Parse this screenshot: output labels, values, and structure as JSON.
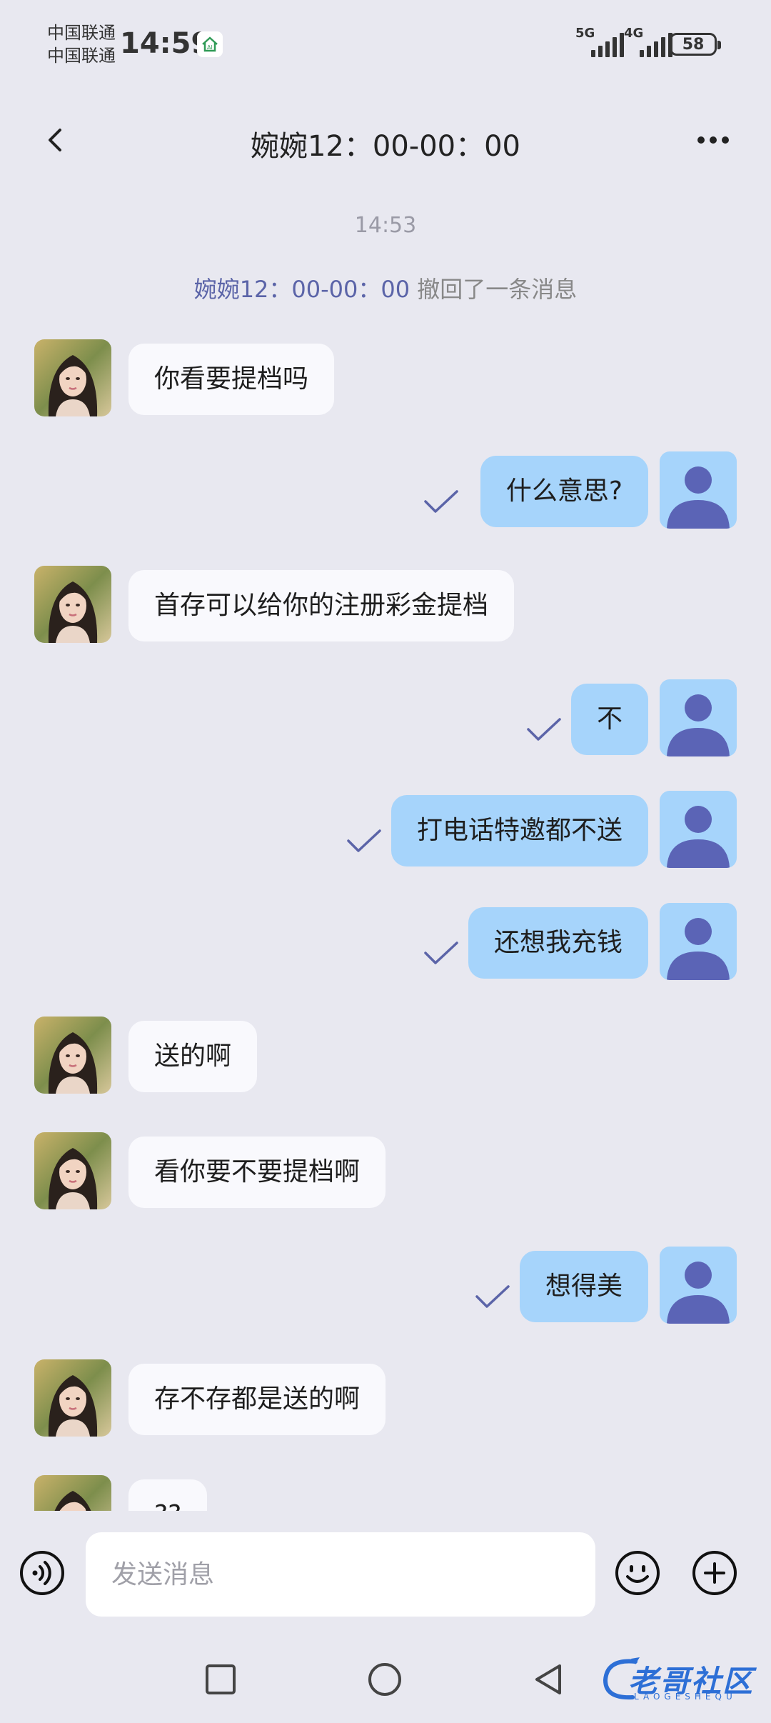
{
  "status_bar": {
    "carrier_1": "中国联通",
    "carrier_2": "中国联通",
    "time": "14:59",
    "signal_1_label": "5G",
    "signal_2_label": "4G",
    "battery": "58"
  },
  "header": {
    "title": "婉婉12：00-00：00",
    "back_icon": "chevron-left-icon",
    "more_icon": "more-horizontal-icon"
  },
  "chat": {
    "time_separator": "14:53",
    "recall_notice": {
      "who": "婉婉12：00-00：00",
      "text": " 撤回了一条消息"
    },
    "messages": [
      {
        "side": "in",
        "text": "你看要提档吗"
      },
      {
        "side": "out",
        "text": "什么意思?",
        "status": "read"
      },
      {
        "side": "in",
        "text": "首存可以给你的注册彩金提档"
      },
      {
        "side": "out",
        "text": "不",
        "status": "read"
      },
      {
        "side": "out",
        "text": "打电话特邀都不送",
        "status": "read"
      },
      {
        "side": "out",
        "text": "还想我充钱",
        "status": "read"
      },
      {
        "side": "in",
        "text": "送的啊"
      },
      {
        "side": "in",
        "text": "看你要不要提档啊"
      },
      {
        "side": "out",
        "text": "想得美",
        "status": "read"
      },
      {
        "side": "in",
        "text": "存不存都是送的啊"
      },
      {
        "side": "in",
        "text": "??"
      }
    ]
  },
  "input": {
    "placeholder": "发送消息",
    "voice_icon": "voice-icon",
    "emoji_icon": "emoji-icon",
    "plus_icon": "plus-circle-icon"
  },
  "watermark": {
    "text": "老哥社区",
    "sub": "LAOGESHEQU"
  },
  "colors": {
    "background": "#e8e8f0",
    "incoming_bubble": "#f9f9fd",
    "outgoing_bubble": "#a6d4fb",
    "accent": "#5b64a8"
  }
}
